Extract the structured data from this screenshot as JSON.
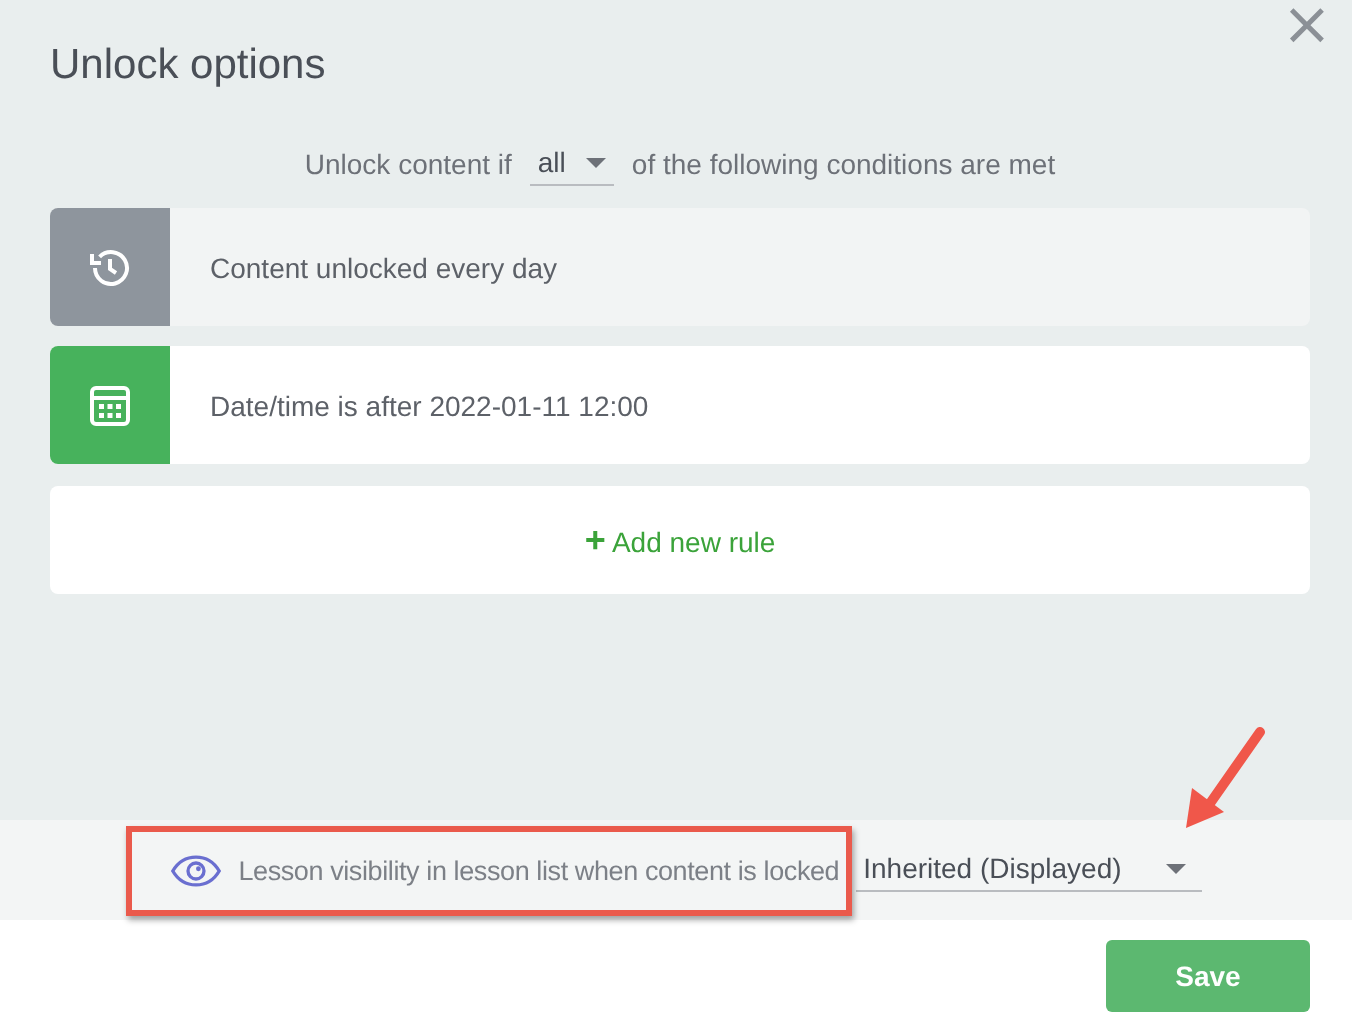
{
  "dialog": {
    "title": "Unlock options",
    "close": "×"
  },
  "condition": {
    "prefix": "Unlock content if",
    "mode": "all",
    "suffix": "of the following conditions are met"
  },
  "rules": [
    {
      "kind": "recurring",
      "text": "Content unlocked every day"
    },
    {
      "kind": "date",
      "text": "Date/time is after 2022-01-11 12:00"
    }
  ],
  "add_rule": {
    "icon": "+",
    "label": "Add new rule"
  },
  "visibility": {
    "label": "Lesson visibility in lesson list when content is locked",
    "value": "Inherited (Displayed)"
  },
  "buttons": [
    {
      "label": "Save"
    }
  ],
  "annotations": {
    "highlight_frame": true,
    "arrow": true
  }
}
